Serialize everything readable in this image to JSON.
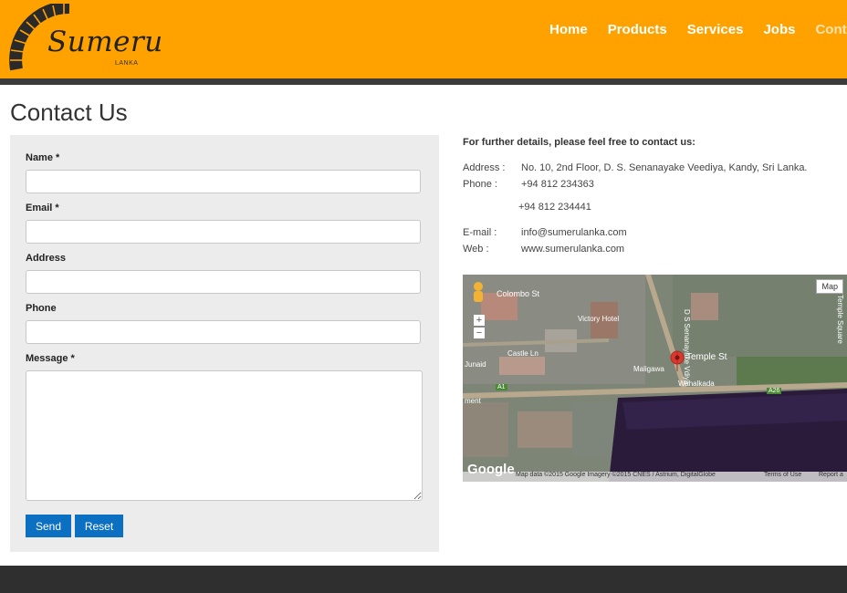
{
  "brand": {
    "name": "Sumeru",
    "sub": "LANKA"
  },
  "nav": [
    "Home",
    "Products",
    "Services",
    "Jobs",
    "Cont"
  ],
  "page_title": "Contact Us",
  "form": {
    "name_label": "Name *",
    "email_label": "Email *",
    "address_label": "Address",
    "phone_label": "Phone",
    "message_label": "Message *",
    "send_label": "Send",
    "reset_label": "Reset"
  },
  "contact": {
    "heading": "For further details, please feel free to contact us:",
    "address_label": "Address :",
    "address_value": "No. 10, 2nd Floor, D. S. Senanayake Veediya, Kandy, Sri Lanka.",
    "phone_label": "Phone :",
    "phone_1": "+94 812 234363",
    "phone_2": "+94 812 234441",
    "email_label": "E-mail :",
    "email_value": "info@sumerulanka.com",
    "web_label": "Web :",
    "web_value": "www.sumerulanka.com"
  },
  "map": {
    "type_button": "Map",
    "zoom_in": "+",
    "zoom_out": "−",
    "labels": [
      "Colombo St",
      "Victory Hotel",
      "Castle Ln",
      "Temple St",
      "Maligawa",
      "Wahalkada",
      "A1",
      "A26",
      "D S Senanayake Vdiya",
      "Temple Square",
      "Junaid",
      "ment"
    ],
    "google": "Google",
    "attribution": "Map data ©2015 Google Imagery ©2015 CNES / Astrium, DigitalGlobe",
    "terms": "Terms of Use",
    "report": "Report a"
  },
  "colors": {
    "header": "#ffa200",
    "accent_button": "#0b6fc2",
    "footer": "#2f2f2f"
  }
}
